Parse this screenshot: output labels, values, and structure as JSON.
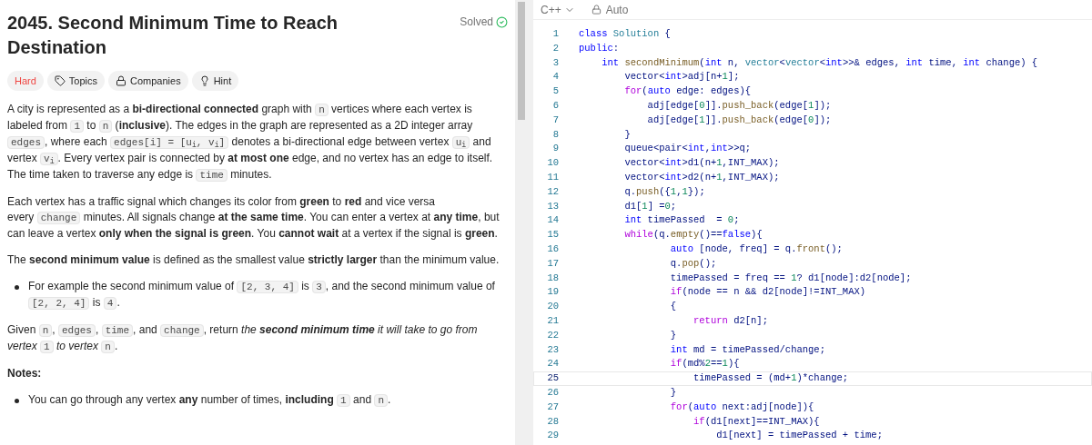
{
  "problem": {
    "title": "2045. Second Minimum Time to Reach Destination",
    "status": "Solved",
    "tags": [
      {
        "kind": "difficulty",
        "label": "Hard"
      },
      {
        "kind": "topics",
        "label": "Topics"
      },
      {
        "kind": "companies",
        "label": "Companies"
      },
      {
        "kind": "hint",
        "label": "Hint"
      }
    ],
    "blocks": [
      {
        "kind": "paragraph",
        "segments": [
          {
            "kind": "text",
            "text": "A city is represented as a **bi-directional connected** graph with "
          },
          {
            "kind": "code",
            "text": "n"
          },
          {
            "kind": "text",
            "text": " vertices where each vertex is labeled from "
          },
          {
            "kind": "code",
            "text": "1"
          },
          {
            "kind": "text",
            "text": " to "
          },
          {
            "kind": "code",
            "text": "n"
          },
          {
            "kind": "text",
            "text": " (**inclusive**). The edges in the graph are represented as a 2D integer array "
          },
          {
            "kind": "code",
            "text": "edges"
          },
          {
            "kind": "text",
            "text": ", where each "
          },
          {
            "kind": "code",
            "text": "edges[i] = [u$_{i}$, v$_{i}$]"
          },
          {
            "kind": "text",
            "text": " denotes a bi-directional edge between vertex "
          },
          {
            "kind": "code",
            "text": "u$_{i}$"
          },
          {
            "kind": "text",
            "text": " and vertex "
          },
          {
            "kind": "code",
            "text": "v$_{i}$"
          },
          {
            "kind": "text",
            "text": ". Every vertex pair is connected by **at most one** edge, and no vertex has an edge to itself. The time taken to traverse any edge is "
          },
          {
            "kind": "code",
            "text": "time"
          },
          {
            "kind": "text",
            "text": " minutes."
          }
        ]
      },
      {
        "kind": "paragraph",
        "segments": [
          {
            "kind": "text",
            "text": "Each vertex has a traffic signal which changes its color from **green** to **red** and vice versa"
          },
          {
            "kind": "break"
          },
          {
            "kind": "text",
            "text": "every "
          },
          {
            "kind": "code",
            "text": "change"
          },
          {
            "kind": "text",
            "text": " minutes. All signals change **at the same time**. You can enter a vertex at **any time**, but can leave a vertex **only when the signal is green**. You **cannot wait** at a vertex if the signal is **green**."
          }
        ]
      },
      {
        "kind": "paragraph",
        "segments": [
          {
            "kind": "text",
            "text": "The **second minimum value** is defined as the smallest value **strictly larger** than the minimum value."
          }
        ]
      },
      {
        "kind": "bullet",
        "segments": [
          {
            "kind": "text",
            "text": "For example the second minimum value of "
          },
          {
            "kind": "code",
            "text": "[2, 3, 4]"
          },
          {
            "kind": "text",
            "text": " is "
          },
          {
            "kind": "code",
            "text": "3"
          },
          {
            "kind": "text",
            "text": ", and the second minimum value of "
          },
          {
            "kind": "code",
            "text": "[2, 2, 4]"
          },
          {
            "kind": "text",
            "text": " is "
          },
          {
            "kind": "code",
            "text": "4"
          },
          {
            "kind": "text",
            "text": "."
          }
        ]
      },
      {
        "kind": "paragraph",
        "segments": [
          {
            "kind": "text",
            "text": "Given "
          },
          {
            "kind": "code",
            "text": "n"
          },
          {
            "kind": "text",
            "text": ", "
          },
          {
            "kind": "code",
            "text": "edges"
          },
          {
            "kind": "text",
            "text": ", "
          },
          {
            "kind": "code",
            "text": "time"
          },
          {
            "kind": "text",
            "text": ", and "
          },
          {
            "kind": "code",
            "text": "change"
          },
          {
            "kind": "text",
            "text": ", return "
          },
          {
            "kind": "em",
            "text": "the **second minimum time** it will take to go from vertex "
          },
          {
            "kind": "code",
            "text": "1"
          },
          {
            "kind": "em",
            "text": " to vertex "
          },
          {
            "kind": "code",
            "text": "n"
          },
          {
            "kind": "text",
            "text": "."
          }
        ]
      },
      {
        "kind": "heading",
        "segments": [
          {
            "kind": "text",
            "text": "Notes:"
          }
        ]
      },
      {
        "kind": "bullet",
        "segments": [
          {
            "kind": "text",
            "text": "You can go through any vertex **any** number of times, **including** "
          },
          {
            "kind": "code",
            "text": "1"
          },
          {
            "kind": "text",
            "text": " and "
          },
          {
            "kind": "code",
            "text": "n"
          },
          {
            "kind": "text",
            "text": "."
          }
        ]
      }
    ]
  },
  "editor": {
    "language": "C++",
    "mode": "Auto",
    "lines": [
      {
        "number": "1",
        "selected": false,
        "tokens": [
          {
            "text": "class",
            "kind": "k"
          },
          {
            "text": " Solution",
            "kind": "t"
          },
          {
            "text": " {",
            "kind": "v"
          }
        ]
      },
      {
        "number": "2",
        "selected": false,
        "tokens": [
          {
            "text": "public",
            "kind": "k"
          },
          {
            "text": ":",
            "kind": "v"
          }
        ]
      },
      {
        "number": "3",
        "selected": false,
        "tokens": [
          {
            "text": "    int",
            "kind": "k"
          },
          {
            "text": " secondMinimum",
            "kind": "f"
          },
          {
            "text": "(",
            "kind": "v"
          },
          {
            "text": "int",
            "kind": "k"
          },
          {
            "text": " n, ",
            "kind": "v"
          },
          {
            "text": "vector",
            "kind": "t"
          },
          {
            "text": "<",
            "kind": "v"
          },
          {
            "text": "vector",
            "kind": "t"
          },
          {
            "text": "<",
            "kind": "v"
          },
          {
            "text": "int",
            "kind": "k"
          },
          {
            "text": ">>& edges, ",
            "kind": "v"
          },
          {
            "text": "int",
            "kind": "k"
          },
          {
            "text": " time, ",
            "kind": "v"
          },
          {
            "text": "int",
            "kind": "k"
          },
          {
            "text": " change) {",
            "kind": "v"
          }
        ]
      },
      {
        "number": "4",
        "selected": false,
        "tokens": [
          {
            "text": "        vector<",
            "kind": "v"
          },
          {
            "text": "int",
            "kind": "k"
          },
          {
            "text": ">adj[n+",
            "kind": "v"
          },
          {
            "text": "1",
            "kind": "n"
          },
          {
            "text": "];",
            "kind": "v"
          }
        ]
      },
      {
        "number": "5",
        "selected": false,
        "tokens": [
          {
            "text": "        for",
            "kind": "c"
          },
          {
            "text": "(",
            "kind": "v"
          },
          {
            "text": "auto",
            "kind": "k"
          },
          {
            "text": " edge: edges){",
            "kind": "v"
          }
        ]
      },
      {
        "number": "6",
        "selected": false,
        "tokens": [
          {
            "text": "            adj[edge[",
            "kind": "v"
          },
          {
            "text": "0",
            "kind": "n"
          },
          {
            "text": "]].",
            "kind": "v"
          },
          {
            "text": "push_back",
            "kind": "f"
          },
          {
            "text": "(edge[",
            "kind": "v"
          },
          {
            "text": "1",
            "kind": "n"
          },
          {
            "text": "]);",
            "kind": "v"
          }
        ]
      },
      {
        "number": "7",
        "selected": false,
        "tokens": [
          {
            "text": "            adj[edge[",
            "kind": "v"
          },
          {
            "text": "1",
            "kind": "n"
          },
          {
            "text": "]].",
            "kind": "v"
          },
          {
            "text": "push_back",
            "kind": "f"
          },
          {
            "text": "(edge[",
            "kind": "v"
          },
          {
            "text": "0",
            "kind": "n"
          },
          {
            "text": "]);",
            "kind": "v"
          }
        ]
      },
      {
        "number": "8",
        "selected": false,
        "tokens": [
          {
            "text": "        }",
            "kind": "v"
          }
        ]
      },
      {
        "number": "9",
        "selected": false,
        "tokens": [
          {
            "text": "        queue<pair<",
            "kind": "v"
          },
          {
            "text": "int",
            "kind": "k"
          },
          {
            "text": ",",
            "kind": "v"
          },
          {
            "text": "int",
            "kind": "k"
          },
          {
            "text": ">>q;",
            "kind": "v"
          }
        ]
      },
      {
        "number": "10",
        "selected": false,
        "tokens": [
          {
            "text": "        vector<",
            "kind": "v"
          },
          {
            "text": "int",
            "kind": "k"
          },
          {
            "text": ">d1(n+",
            "kind": "v"
          },
          {
            "text": "1",
            "kind": "n"
          },
          {
            "text": ",INT_MAX);",
            "kind": "v"
          }
        ]
      },
      {
        "number": "11",
        "selected": false,
        "tokens": [
          {
            "text": "        vector<",
            "kind": "v"
          },
          {
            "text": "int",
            "kind": "k"
          },
          {
            "text": ">d2(n+",
            "kind": "v"
          },
          {
            "text": "1",
            "kind": "n"
          },
          {
            "text": ",INT_MAX);",
            "kind": "v"
          }
        ]
      },
      {
        "number": "12",
        "selected": false,
        "tokens": [
          {
            "text": "        q.",
            "kind": "v"
          },
          {
            "text": "push",
            "kind": "f"
          },
          {
            "text": "({",
            "kind": "v"
          },
          {
            "text": "1",
            "kind": "n"
          },
          {
            "text": ",",
            "kind": "v"
          },
          {
            "text": "1",
            "kind": "n"
          },
          {
            "text": "});",
            "kind": "v"
          }
        ]
      },
      {
        "number": "13",
        "selected": false,
        "tokens": [
          {
            "text": "        d1[",
            "kind": "v"
          },
          {
            "text": "1",
            "kind": "n"
          },
          {
            "text": "] =",
            "kind": "v"
          },
          {
            "text": "0",
            "kind": "n"
          },
          {
            "text": ";",
            "kind": "v"
          }
        ]
      },
      {
        "number": "14",
        "selected": false,
        "tokens": [
          {
            "text": "        int",
            "kind": "k"
          },
          {
            "text": " timePassed  = ",
            "kind": "v"
          },
          {
            "text": "0",
            "kind": "n"
          },
          {
            "text": ";",
            "kind": "v"
          }
        ]
      },
      {
        "number": "15",
        "selected": false,
        "tokens": [
          {
            "text": "        while",
            "kind": "c"
          },
          {
            "text": "(q.",
            "kind": "v"
          },
          {
            "text": "empty",
            "kind": "f"
          },
          {
            "text": "()==",
            "kind": "v"
          },
          {
            "text": "false",
            "kind": "k"
          },
          {
            "text": "){",
            "kind": "v"
          }
        ]
      },
      {
        "number": "16",
        "selected": false,
        "tokens": [
          {
            "text": "                auto",
            "kind": "k"
          },
          {
            "text": " [node, freq] = q.",
            "kind": "v"
          },
          {
            "text": "front",
            "kind": "f"
          },
          {
            "text": "();",
            "kind": "v"
          }
        ]
      },
      {
        "number": "17",
        "selected": false,
        "tokens": [
          {
            "text": "                q.",
            "kind": "v"
          },
          {
            "text": "pop",
            "kind": "f"
          },
          {
            "text": "();",
            "kind": "v"
          }
        ]
      },
      {
        "number": "18",
        "selected": false,
        "tokens": [
          {
            "text": "                timePassed = freq == ",
            "kind": "v"
          },
          {
            "text": "1",
            "kind": "n"
          },
          {
            "text": "? d1[node]:d2[node];",
            "kind": "v"
          }
        ]
      },
      {
        "number": "19",
        "selected": false,
        "tokens": [
          {
            "text": "                if",
            "kind": "c"
          },
          {
            "text": "(node == n && d2[node]!=INT_MAX)",
            "kind": "v"
          }
        ]
      },
      {
        "number": "20",
        "selected": false,
        "tokens": [
          {
            "text": "                {",
            "kind": "v"
          }
        ]
      },
      {
        "number": "21",
        "selected": false,
        "tokens": [
          {
            "text": "                    return",
            "kind": "c"
          },
          {
            "text": " d2[n];",
            "kind": "v"
          }
        ]
      },
      {
        "number": "22",
        "selected": false,
        "tokens": [
          {
            "text": "                }",
            "kind": "v"
          }
        ]
      },
      {
        "number": "23",
        "selected": false,
        "tokens": [
          {
            "text": "                int",
            "kind": "k"
          },
          {
            "text": " md = timePassed/change;",
            "kind": "v"
          }
        ]
      },
      {
        "number": "24",
        "selected": false,
        "tokens": [
          {
            "text": "                if",
            "kind": "c"
          },
          {
            "text": "(md%",
            "kind": "v"
          },
          {
            "text": "2",
            "kind": "n"
          },
          {
            "text": "==",
            "kind": "v"
          },
          {
            "text": "1",
            "kind": "n"
          },
          {
            "text": "){",
            "kind": "v"
          }
        ]
      },
      {
        "number": "25",
        "selected": true,
        "tokens": [
          {
            "text": "                    timePassed = (md+",
            "kind": "v"
          },
          {
            "text": "1",
            "kind": "n"
          },
          {
            "text": ")*change;",
            "kind": "v"
          }
        ]
      },
      {
        "number": "26",
        "selected": false,
        "tokens": [
          {
            "text": "                }",
            "kind": "v"
          }
        ]
      },
      {
        "number": "27",
        "selected": false,
        "tokens": [
          {
            "text": "                for",
            "kind": "c"
          },
          {
            "text": "(",
            "kind": "v"
          },
          {
            "text": "auto",
            "kind": "k"
          },
          {
            "text": " next:adj[node]){",
            "kind": "v"
          }
        ]
      },
      {
        "number": "28",
        "selected": false,
        "tokens": [
          {
            "text": "                    if",
            "kind": "c"
          },
          {
            "text": "(d1[next]==INT_MAX){",
            "kind": "v"
          }
        ]
      },
      {
        "number": "29",
        "selected": false,
        "tokens": [
          {
            "text": "                        d1[next] = timePassed + time;",
            "kind": "v"
          }
        ]
      }
    ]
  }
}
